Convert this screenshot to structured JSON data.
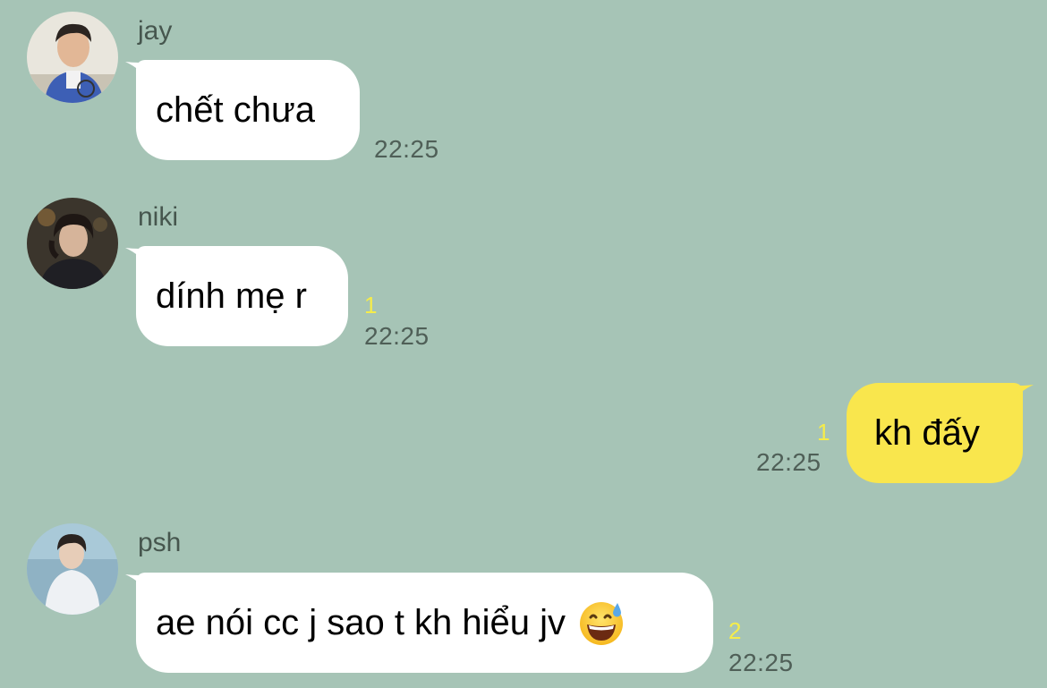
{
  "messages": [
    {
      "sender": "jay",
      "direction": "incoming",
      "avatar_icon": "avatar-jay-icon",
      "text": "chết chưa",
      "time": "22:25",
      "unread": ""
    },
    {
      "sender": "niki",
      "direction": "incoming",
      "avatar_icon": "avatar-niki-icon",
      "text": "dính mẹ r",
      "time": "22:25",
      "unread": "1"
    },
    {
      "sender": "",
      "direction": "outgoing",
      "text": "kh đấy",
      "time": "22:25",
      "unread": "1"
    },
    {
      "sender": "psh",
      "direction": "incoming",
      "avatar_icon": "avatar-psh-icon",
      "text": "ae nói cc j sao t kh hiểu jv",
      "emoji_icon": "grinning-sweat-emoji-icon",
      "time": "22:25",
      "unread": "2"
    }
  ],
  "colors": {
    "background": "#a6c4b6",
    "incoming_bubble": "#ffffff",
    "outgoing_bubble": "#f9e64d",
    "unread_count": "#f5ec4a",
    "timestamp": "#4f5f57"
  }
}
